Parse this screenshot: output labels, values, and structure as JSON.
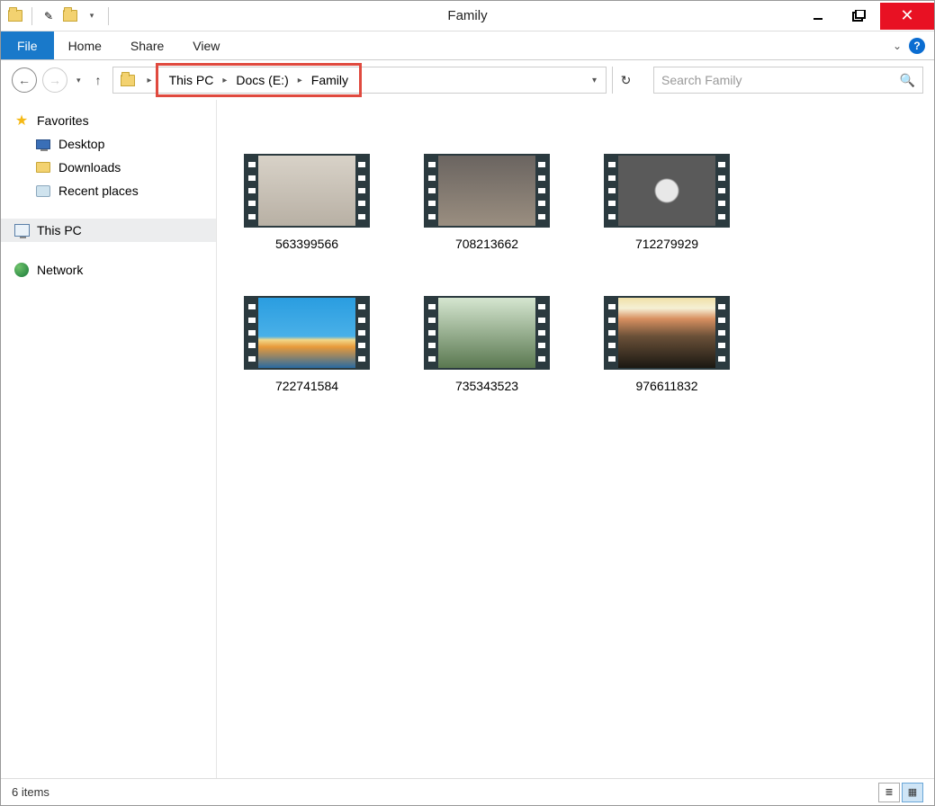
{
  "window": {
    "title": "Family"
  },
  "tabs": {
    "file": "File",
    "home": "Home",
    "share": "Share",
    "view": "View"
  },
  "breadcrumb": {
    "sep": "▸",
    "items": [
      "This PC",
      "Docs (E:)",
      "Family"
    ]
  },
  "search": {
    "placeholder": "Search Family"
  },
  "sidebar": {
    "favorites": {
      "label": "Favorites",
      "items": [
        {
          "label": "Desktop"
        },
        {
          "label": "Downloads"
        },
        {
          "label": "Recent places"
        }
      ]
    },
    "thispc": {
      "label": "This PC"
    },
    "network": {
      "label": "Network"
    }
  },
  "files": [
    {
      "name": "563399566"
    },
    {
      "name": "708213662"
    },
    {
      "name": "712279929"
    },
    {
      "name": "722741584"
    },
    {
      "name": "735343523"
    },
    {
      "name": "976611832"
    }
  ],
  "status": {
    "count_label": "6 items"
  }
}
